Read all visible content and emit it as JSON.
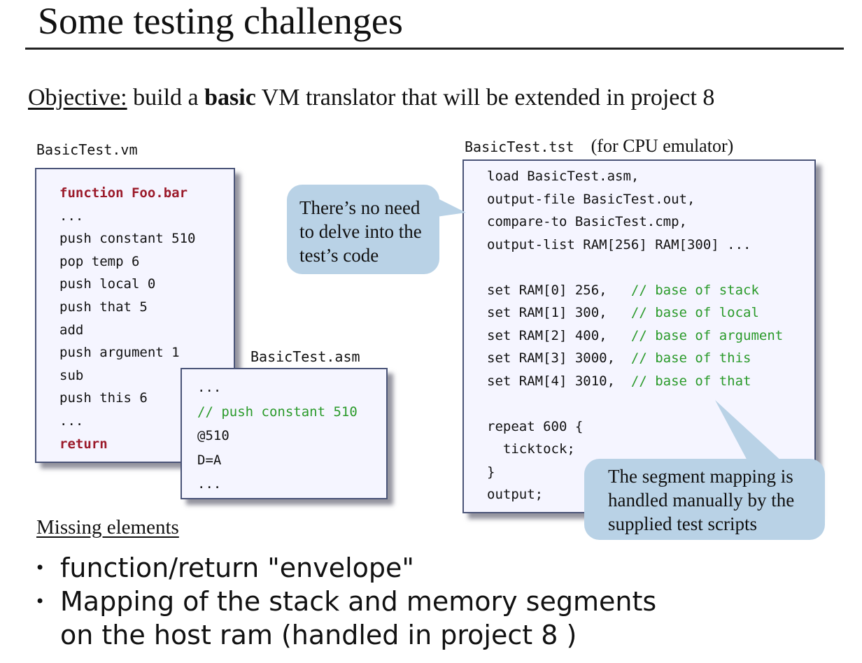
{
  "title": "Some testing challenges",
  "objective": {
    "label": "Objective:",
    "pre": " build a ",
    "bold": "basic",
    "post": " VM translator that will be extended in project 8"
  },
  "vm_file": {
    "name": "BasicTest.vm",
    "lines": [
      {
        "text": "function Foo.bar",
        "style": "kw"
      },
      {
        "text": "...",
        "style": ""
      },
      {
        "text": "push constant 510",
        "style": ""
      },
      {
        "text": "pop temp 6",
        "style": ""
      },
      {
        "text": "push local 0",
        "style": ""
      },
      {
        "text": "push that 5",
        "style": ""
      },
      {
        "text": "add",
        "style": ""
      },
      {
        "text": "push argument 1",
        "style": ""
      },
      {
        "text": "sub",
        "style": ""
      },
      {
        "text": "push this 6",
        "style": ""
      },
      {
        "text": "...",
        "style": ""
      },
      {
        "text": "return",
        "style": "kw"
      }
    ]
  },
  "asm_file": {
    "name": "BasicTest.asm",
    "lines": [
      {
        "text": "...",
        "style": ""
      },
      {
        "text": "// push constant 510",
        "style": "cm"
      },
      {
        "text": "@510",
        "style": ""
      },
      {
        "text": "D=A",
        "style": ""
      },
      {
        "text": "...",
        "style": ""
      }
    ]
  },
  "tst_file": {
    "name": "BasicTest.tst",
    "note": "(for CPU emulator)",
    "lines": [
      {
        "code": "load BasicTest.asm,",
        "comment": ""
      },
      {
        "code": "output-file BasicTest.out,",
        "comment": ""
      },
      {
        "code": "compare-to BasicTest.cmp,",
        "comment": ""
      },
      {
        "code": "output-list RAM[256] RAM[300] ...",
        "comment": ""
      },
      {
        "code": "",
        "comment": ""
      },
      {
        "code": "set RAM[0] 256,   ",
        "comment": "// base of stack"
      },
      {
        "code": "set RAM[1] 300,   ",
        "comment": "// base of local"
      },
      {
        "code": "set RAM[2] 400,   ",
        "comment": "// base of argument"
      },
      {
        "code": "set RAM[3] 3000,  ",
        "comment": "// base of this"
      },
      {
        "code": "set RAM[4] 3010,  ",
        "comment": "// base of that"
      },
      {
        "code": "",
        "comment": ""
      },
      {
        "code": "repeat 600 {",
        "comment": ""
      },
      {
        "code": "  ticktock;",
        "comment": ""
      },
      {
        "code": "}",
        "comment": ""
      },
      {
        "code": "output;",
        "comment": ""
      }
    ]
  },
  "callout_test_code": "There’s no need\nto delve into the\ntest’s code",
  "callout_segment": "The segment mapping is\nhandled manually by the\nsupplied test scripts",
  "missing_heading": "Missing elements",
  "bullets": [
    {
      "lines": [
        "function/return \"envelope\""
      ]
    },
    {
      "lines": [
        "Mapping of the stack and memory segments",
        "on the host ram (handled in project 8 )"
      ]
    }
  ],
  "colors": {
    "keyword": "#9b1a2a",
    "comment": "#2a9a2a",
    "callout": "#b9d2e6",
    "box_border": "#4a5478",
    "box_bg": "#f5f5ff"
  },
  "icons": [
    "bullet-dot"
  ]
}
